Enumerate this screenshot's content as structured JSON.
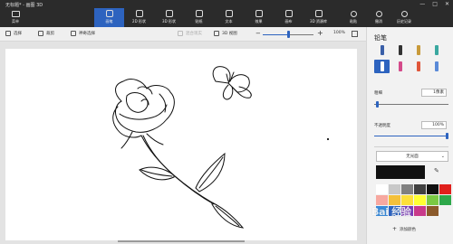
{
  "window": {
    "title": "无标题* - 画图 3D",
    "controls": [
      "—",
      "□",
      "✕"
    ]
  },
  "menu": {
    "label": "菜单"
  },
  "ribbon": {
    "tools": [
      {
        "label": "画笔",
        "icon": "brush-icon",
        "active": true
      },
      {
        "label": "2D 形状",
        "icon": "shape-2d-icon",
        "active": false
      },
      {
        "label": "3D 形状",
        "icon": "shape-3d-icon",
        "active": false
      },
      {
        "label": "贴纸",
        "icon": "sticker-icon",
        "active": false
      },
      {
        "label": "文本",
        "icon": "text-icon",
        "active": false
      },
      {
        "label": "效果",
        "icon": "effects-icon",
        "active": false
      },
      {
        "label": "画布",
        "icon": "canvas-icon",
        "active": false
      },
      {
        "label": "3D 资源库",
        "icon": "library-icon",
        "active": false
      }
    ],
    "right_tools": [
      {
        "label": "粘贴",
        "icon": "paste-icon"
      },
      {
        "label": "撤消",
        "icon": "undo-icon"
      },
      {
        "label": "历史记录",
        "icon": "history-icon"
      }
    ]
  },
  "commands": {
    "select": "选择",
    "crop": "裁剪",
    "magic_select": "神奇选择",
    "view_3d_toggle": "混合现实",
    "view_3d": "3D 视图",
    "zoom_value": "100%",
    "zoom_level": 0.5
  },
  "panel": {
    "title": "铅笔",
    "brushes": [
      {
        "icon": "marker-icon",
        "color": "#3a5fa8",
        "selected": false
      },
      {
        "icon": "calligraphy-pen-icon",
        "color": "#333333",
        "selected": false
      },
      {
        "icon": "oil-brush-icon",
        "color": "#c89a3a",
        "selected": false
      },
      {
        "icon": "watercolor-icon",
        "color": "#3aa8a0",
        "selected": false
      },
      {
        "icon": "pencil-icon",
        "color": "#ffffff",
        "selected": true
      },
      {
        "icon": "eraser-icon",
        "color": "#d44a8a",
        "selected": false
      },
      {
        "icon": "crayon-icon",
        "color": "#e0563a",
        "selected": false
      },
      {
        "icon": "pixel-pen-icon",
        "color": "#5a8ad8",
        "selected": false
      }
    ],
    "thickness_label": "粗细",
    "thickness_value": "1像素",
    "thickness_level": 0.02,
    "opacity_label": "不透明度",
    "opacity_value": "100%",
    "opacity_level": 1.0,
    "finish_label": "无光面",
    "current_color": "#111111",
    "palette": [
      "#ffffff",
      "#c8c8c8",
      "#808080",
      "#404040",
      "#111111",
      "#e0201c",
      "#f7a8a0",
      "#f4c03a",
      "#fde03a",
      "#ffff33",
      "#7ac943",
      "#2da84a",
      "#3a8ad8",
      "#2d63bf",
      "#7a3ab8",
      "#c83a8a",
      "#8b5a2b",
      "#f2f2f2"
    ],
    "add_color_label": "添加颜色"
  },
  "watermark": "Bai 经验"
}
